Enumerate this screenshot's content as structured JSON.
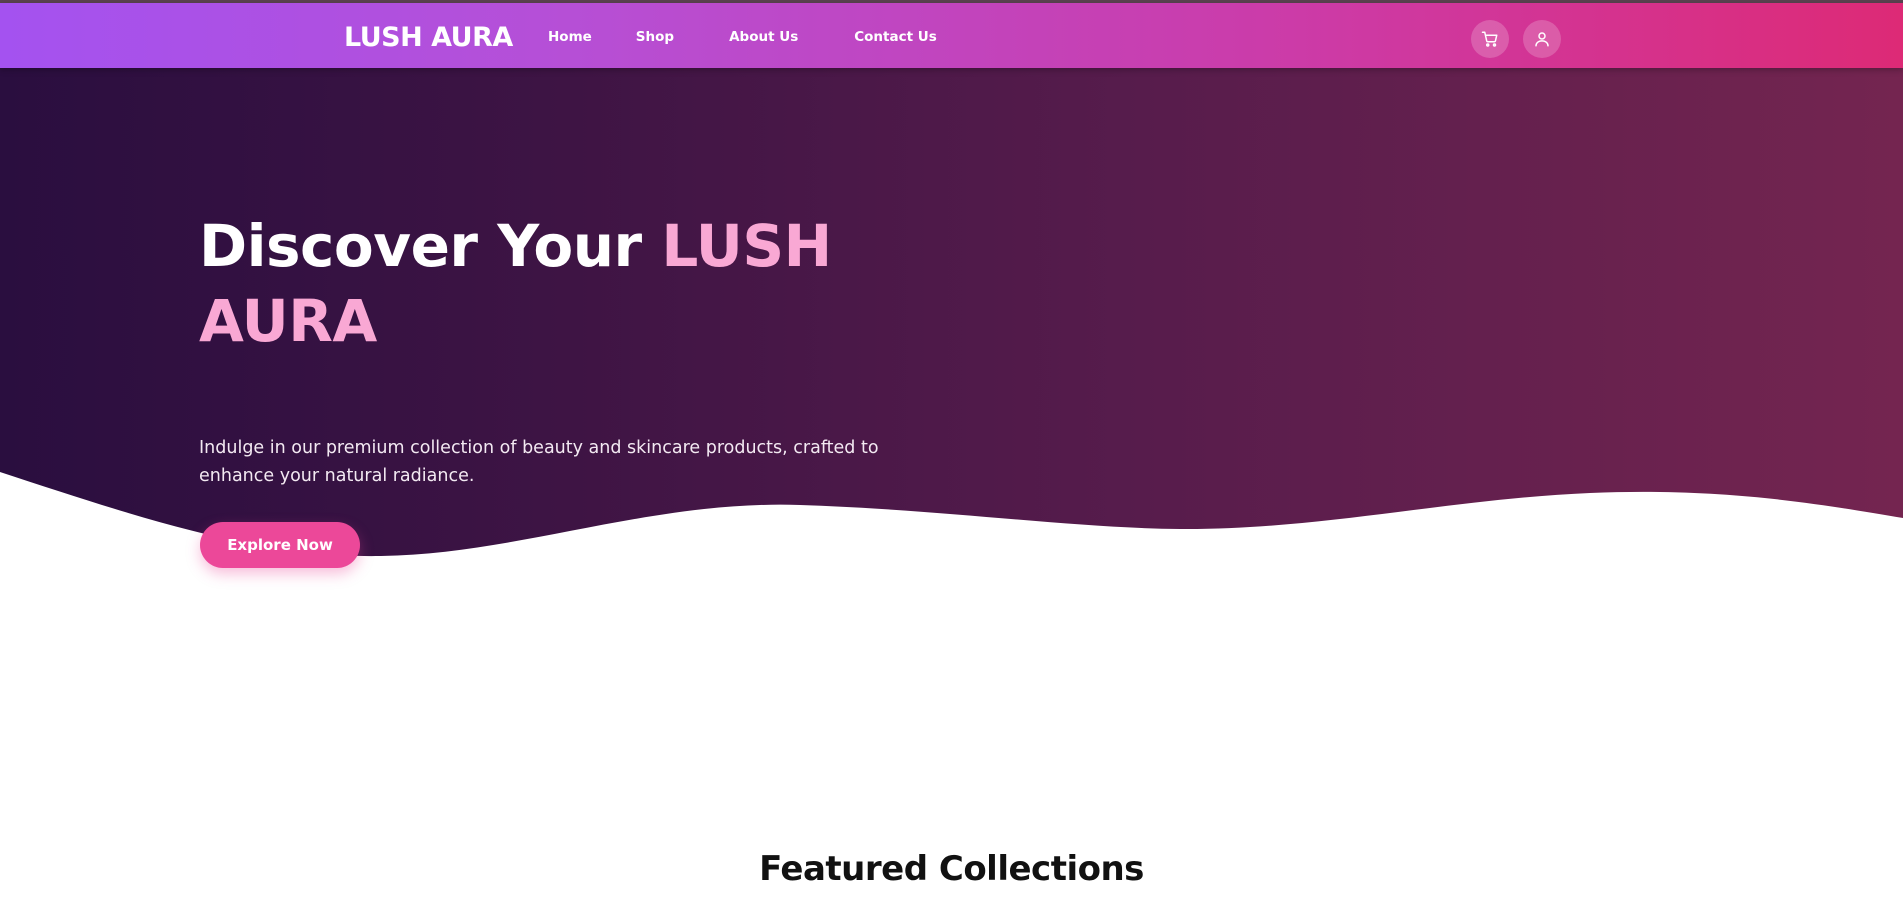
{
  "brand": {
    "name": "LUSH AURA"
  },
  "nav": {
    "items": [
      {
        "label": "Home"
      },
      {
        "label": "Shop"
      },
      {
        "label": "About Us"
      },
      {
        "label": "Contact Us"
      }
    ]
  },
  "actions": {
    "cart_icon": "cart-icon",
    "user_icon": "user-icon"
  },
  "hero": {
    "title_main": "Discover Your ",
    "title_accent": "LUSH AURA",
    "subtitle": "Indulge in our premium collection of beauty and skincare products, crafted to enhance your natural radiance.",
    "cta_label": "Explore Now"
  },
  "featured": {
    "title": "Featured Collections"
  },
  "colors": {
    "nav_gradient_start": "#a452f0",
    "nav_gradient_end": "#dd2a76",
    "hero_gradient_start": "#2a0e3f",
    "hero_gradient_end": "#742550",
    "accent_pink": "#f9a8d4",
    "button_pink": "#ec4899"
  }
}
